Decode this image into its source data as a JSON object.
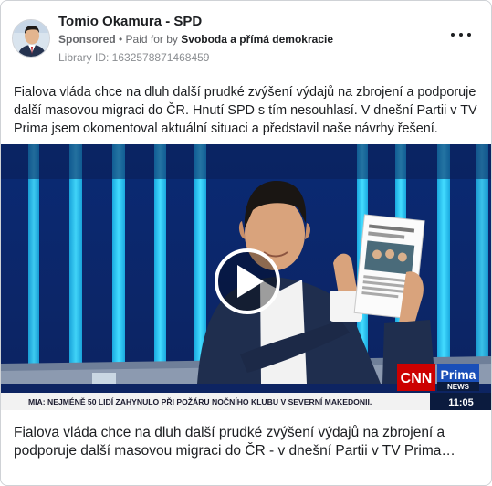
{
  "post": {
    "page_name": "Tomio Okamura - SPD",
    "sponsored_label": "Sponsored",
    "paid_for_prefix": "• Paid for by",
    "funder": "Svoboda a přímá demokracie",
    "library_id": "Library ID: 1632578871468459",
    "body": "Fialova vláda chce na dluh další prudké zvýšení výdajů na zbrojení a podporuje další masovou migraci do ČR. Hnutí SPD s tím nesouhlasí. V dnešní Partii v TV Prima jsem okomentoval aktuální situaci a představil naše návrhy řešení.",
    "more_icon": "more-horizontal-icon"
  },
  "video": {
    "ticker_text": "MIA: NEJMÉNĚ 50 LIDÍ ZAHYNULO PŘI POŽÁRU NOČNÍHO KLUBU V SEVERNÍ MAKEDONII.",
    "logo_cnn": "CNN",
    "logo_prima": "Prima",
    "logo_news": "NEWS",
    "clock": "11:05",
    "play_icon": "play-icon"
  },
  "link_caption": "Fialova vláda chce na dluh další prudké zvýšení výdajů na zbrojení a podporuje další masovou migraci do ČR - v dnešní Partii v TV Prima…",
  "colors": {
    "studio_blue": "#0c2b72",
    "light_bar": "#27c9f0",
    "cnn_red": "#cc0000",
    "prima_blue": "#1a4fb8",
    "ticker_bg": "#f2f2f2",
    "clock_bg": "#0b1b3e"
  }
}
